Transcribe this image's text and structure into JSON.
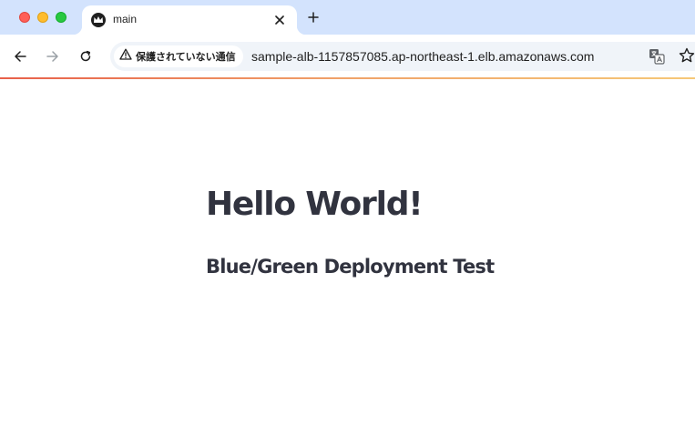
{
  "browser": {
    "tab": {
      "title": "main"
    },
    "address_bar": {
      "security_label": "保護されていない通信",
      "url": "sample-alb-1157857085.ap-northeast-1.elb.amazonaws.com"
    },
    "icons": {
      "back": "arrow-left-icon",
      "forward": "arrow-right-icon",
      "reload": "reload-icon",
      "warning": "warning-triangle-icon",
      "translate": "translate-icon",
      "bookmark": "star-icon"
    }
  },
  "page": {
    "heading": "Hello World!",
    "subheading": "Blue/Green Deployment Test"
  },
  "colors": {
    "tab_strip": "#d3e3fd",
    "text": "#31333f",
    "accent_gradient_start": "#e8604a",
    "accent_gradient_end": "#f6c878"
  }
}
